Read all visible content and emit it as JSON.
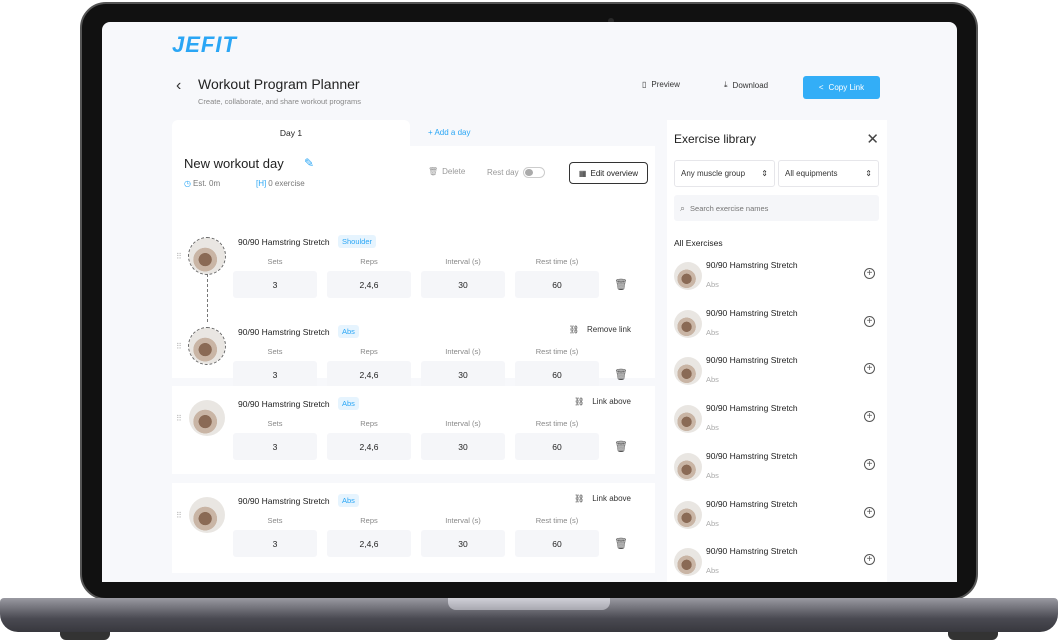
{
  "app": {
    "logo": "JEFIT"
  },
  "header": {
    "back_icon": "‹",
    "title": "Workout Program Planner",
    "subtitle": "Create, collaborate, and share workout programs",
    "preview_label": "Preview",
    "download_label": "Download",
    "copy_link_label": "Copy Link"
  },
  "tabs": {
    "active": "Day 1",
    "add": "+ Add a day"
  },
  "day": {
    "name": "New workout day",
    "est": "Est. 0m",
    "exercise_count": "0 exercise",
    "delete_label": "Delete",
    "rest_day_label": "Rest day",
    "rest_day_on": false,
    "edit_overview_label": "Edit overview"
  },
  "columns": {
    "sets": "Sets",
    "reps": "Reps",
    "interval": "Interval (s)",
    "rest": "Rest time (s)"
  },
  "exercises": [
    {
      "name": "90/90 Hamstring Stretch",
      "tag": "Shoulder",
      "sets": "3",
      "reps": "2,4,6",
      "interval": "30",
      "rest": "60",
      "link": ""
    },
    {
      "name": "90/90 Hamstring Stretch",
      "tag": "Abs",
      "sets": "3",
      "reps": "2,4,6",
      "interval": "30",
      "rest": "60",
      "link": "Remove link"
    },
    {
      "name": "90/90 Hamstring Stretch",
      "tag": "Abs",
      "sets": "3",
      "reps": "2,4,6",
      "interval": "30",
      "rest": "60",
      "link": "Link above"
    },
    {
      "name": "90/90 Hamstring Stretch",
      "tag": "Abs",
      "sets": "3",
      "reps": "2,4,6",
      "interval": "30",
      "rest": "60",
      "link": "Link above"
    }
  ],
  "library": {
    "title": "Exercise library",
    "muscle_select": "Any muscle group",
    "equipment_select": "All equipments",
    "search_placeholder": "Search exercise names",
    "section": "All Exercises",
    "items": [
      {
        "name": "90/90 Hamstring Stretch",
        "sub": "Abs"
      },
      {
        "name": "90/90 Hamstring Stretch",
        "sub": "Abs"
      },
      {
        "name": "90/90 Hamstring Stretch",
        "sub": "Abs"
      },
      {
        "name": "90/90 Hamstring Stretch",
        "sub": "Abs"
      },
      {
        "name": "90/90 Hamstring Stretch",
        "sub": "Abs"
      },
      {
        "name": "90/90 Hamstring Stretch",
        "sub": "Abs"
      },
      {
        "name": "90/90 Hamstring Stretch",
        "sub": "Abs"
      }
    ]
  }
}
